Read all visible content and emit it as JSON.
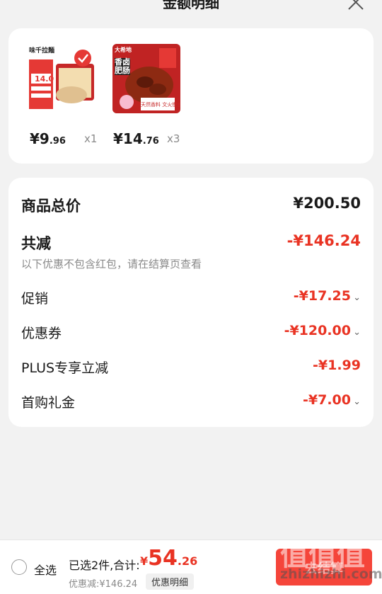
{
  "header": {
    "title": "金额明细"
  },
  "products": [
    {
      "price_int": "¥9",
      "price_dec": ".96",
      "qty": "x1",
      "image": {
        "brand": "味千拉麵",
        "tag": "14.0",
        "selected": true
      }
    },
    {
      "price_int": "¥14",
      "price_dec": ".76",
      "qty": "x3",
      "image": {
        "brand": "大希地",
        "title": "香卤肥肠",
        "caption": "天然香料 文火慢卤"
      }
    }
  ],
  "summary": {
    "total_label": "商品总价",
    "total_value": "¥200.50",
    "reduce_label": "共减",
    "reduce_value": "-¥146.24",
    "note": "以下优惠不包含红包，请在结算页查看",
    "lines": [
      {
        "label": "促销",
        "value": "-¥17.25",
        "expandable": true
      },
      {
        "label": "优惠券",
        "value": "-¥120.00",
        "expandable": true
      },
      {
        "label": "PLUS专享立减",
        "value": "-¥1.99",
        "expandable": false
      },
      {
        "label": "首购礼金",
        "value": "-¥7.00",
        "expandable": true
      }
    ]
  },
  "bottom": {
    "select_all": "全选",
    "selected_text": "已选2件,合计:",
    "total_currency": "¥",
    "total_int": "54",
    "total_dec": ".26",
    "discount_text": "优惠减:¥146.24",
    "detail_button": "优惠明细",
    "checkout_label": "去结算"
  },
  "watermark": {
    "big": "值值值",
    "url": "zhizhizhi.com"
  },
  "colors": {
    "accent": "#e93323",
    "checkout": "#f5453a",
    "background": "#f2f2f2"
  }
}
